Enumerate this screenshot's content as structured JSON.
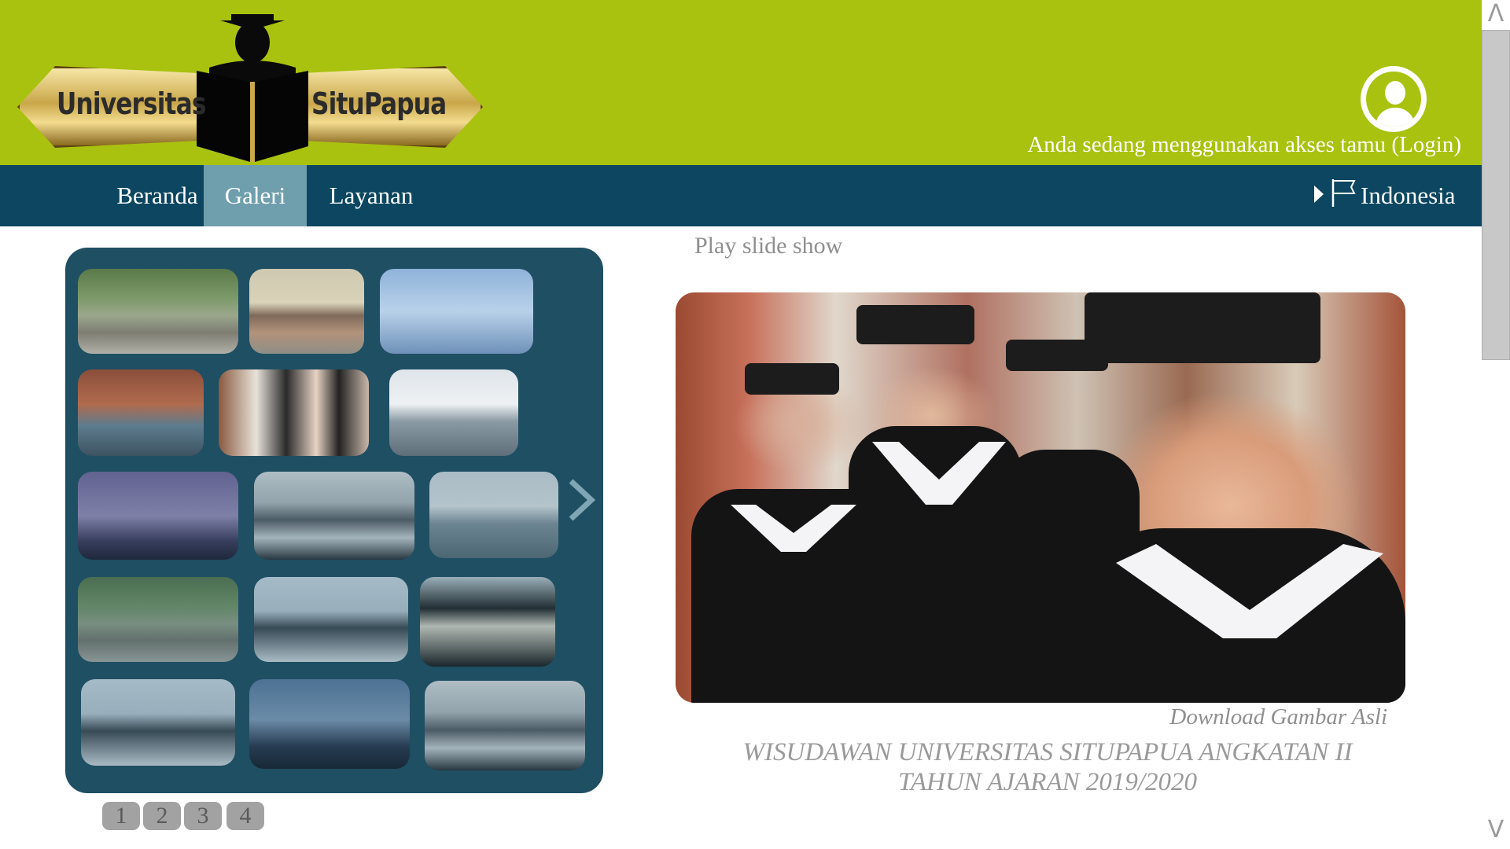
{
  "header": {
    "logo": {
      "text_left": "Universitas",
      "text_right": "SituPapua"
    },
    "access_text": "Anda sedang menggunakan akses tamu (Login)",
    "user_icon": "user-icon"
  },
  "nav": {
    "items": [
      {
        "label": "Beranda",
        "active": false
      },
      {
        "label": "Galeri",
        "active": true
      },
      {
        "label": "Layanan",
        "active": false
      }
    ],
    "language": {
      "label": "Indonesia",
      "icon": "flag-icon"
    }
  },
  "gallery": {
    "thumbnails": [
      "campus-walk",
      "meeting-room",
      "caps-thrown",
      "students-backpacks",
      "graduates-smiling",
      "classroom-presentation",
      "graduate-silhouettes",
      "exam-hall",
      "classroom-presentation",
      "campus-walk",
      "students-table",
      "graduates-group",
      "students-table",
      "graduate-silhouettes",
      "exam-hall"
    ],
    "next_icon": "chevron-right-icon",
    "pages": [
      "1",
      "2",
      "3",
      "4"
    ]
  },
  "viewer": {
    "play_label": "Play slide show",
    "download_label": "Download Gambar Asli",
    "caption_line1": "WISUDAWAN UNIVERSITAS SITUPAPUA ANGKATAN II",
    "caption_line2": "TAHUN AJARAN 2019/2020"
  },
  "scrollbar": {
    "up": "Λ",
    "down": "V"
  },
  "colors": {
    "header_bg": "#a9c20f",
    "nav_bg": "#0c4660",
    "nav_active": "#6f9eac",
    "gallery_bg": "#1f4f63"
  }
}
